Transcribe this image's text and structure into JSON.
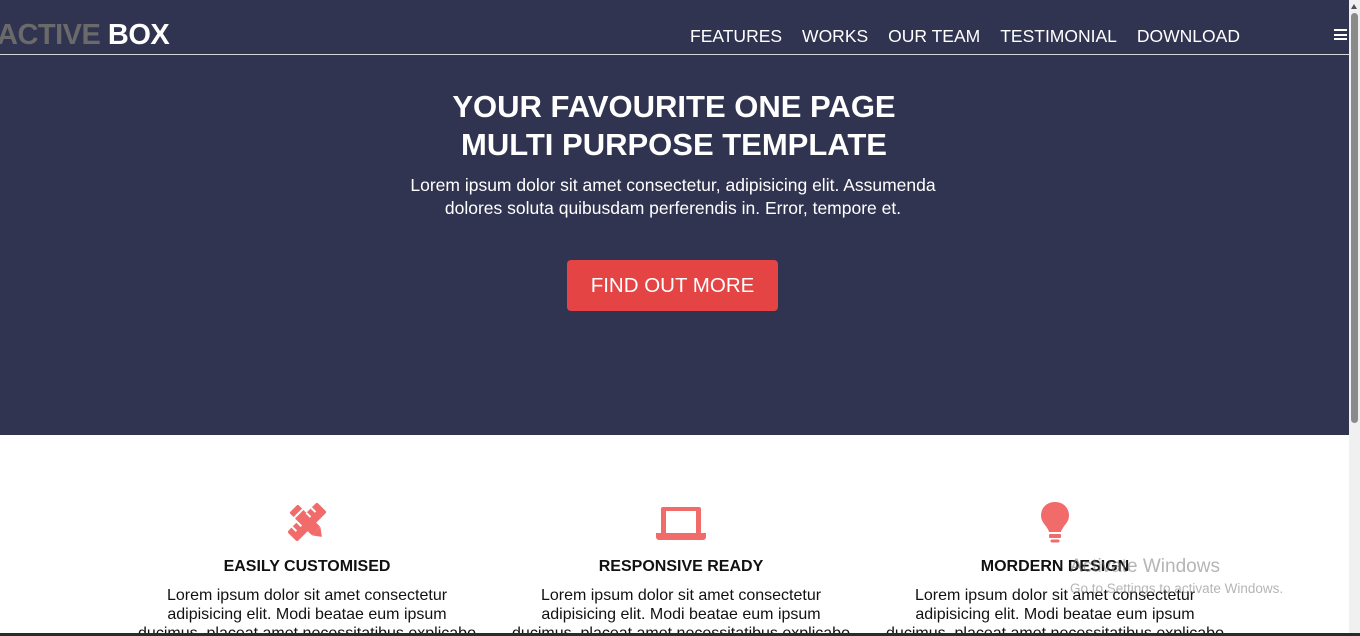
{
  "brand": {
    "light": "ACTIVE",
    "strong": "BOX"
  },
  "nav": {
    "links": [
      "FEATURES",
      "WORKS",
      "OUR TEAM",
      "TESTIMONIAL",
      "DOWNLOAD"
    ],
    "menu_icon": "hamburger-icon"
  },
  "hero": {
    "title_line1": "YOUR FAVOURITE ONE PAGE",
    "title_line2": "MULTI PURPOSE TEMPLATE",
    "subtitle_line1": "Lorem ipsum dolor sit amet consectetur, adipisicing elit. Assumenda",
    "subtitle_line2": "dolores soluta quibusdam perferendis in. Error, tempore et.",
    "cta_label": "FIND OUT MORE"
  },
  "features": [
    {
      "icon": "pencil-ruler-icon",
      "title": "EASILY CUSTOMISED",
      "lines": [
        "Lorem ipsum dolor sit amet consectetur",
        "adipisicing elit. Modi beatae eum ipsum",
        "ducimus, placeat amet necessitatibus explicabo"
      ]
    },
    {
      "icon": "laptop-icon",
      "title": "RESPONSIVE READY",
      "lines": [
        "Lorem ipsum dolor sit amet consectetur",
        "adipisicing elit. Modi beatae eum ipsum",
        "ducimus, placeat amet necessitatibus explicabo"
      ]
    },
    {
      "icon": "lightbulb-icon",
      "title": "MORDERN DESIGN",
      "lines": [
        "Lorem ipsum dolor sit amet consectetur",
        "adipisicing elit. Modi beatae eum ipsum",
        "ducimus, placeat amet necessitatibus explicabo"
      ]
    }
  ],
  "watermark": {
    "title": "Activate Windows",
    "subtitle": "Go to Settings to activate Windows."
  },
  "colors": {
    "hero_background": "#313450",
    "accent": "#e44444",
    "icon": "#f26b6b",
    "brand_muted": "#6a6a6a"
  }
}
